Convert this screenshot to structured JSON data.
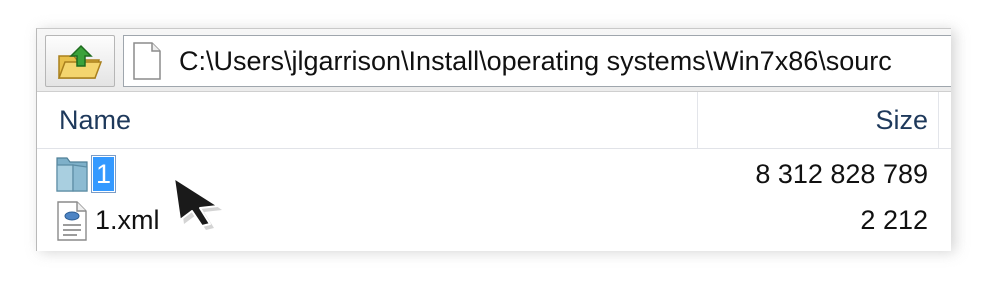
{
  "toolbar": {
    "up_button_icon": "folder-up-icon",
    "path_icon": "document-icon",
    "path": "C:\\Users\\jlgarrison\\Install\\operating systems\\Win7x86\\sourc"
  },
  "columns": {
    "name": "Name",
    "size": "Size"
  },
  "files": [
    {
      "name": "1",
      "size": "8 312 828 789",
      "icon": "folder-icon",
      "renaming": true
    },
    {
      "name": "1.xml",
      "size": "2 212",
      "icon": "xml-file-icon",
      "renaming": false
    }
  ],
  "colors": {
    "selection": "#3399ff",
    "header_text": "#1e395b"
  }
}
